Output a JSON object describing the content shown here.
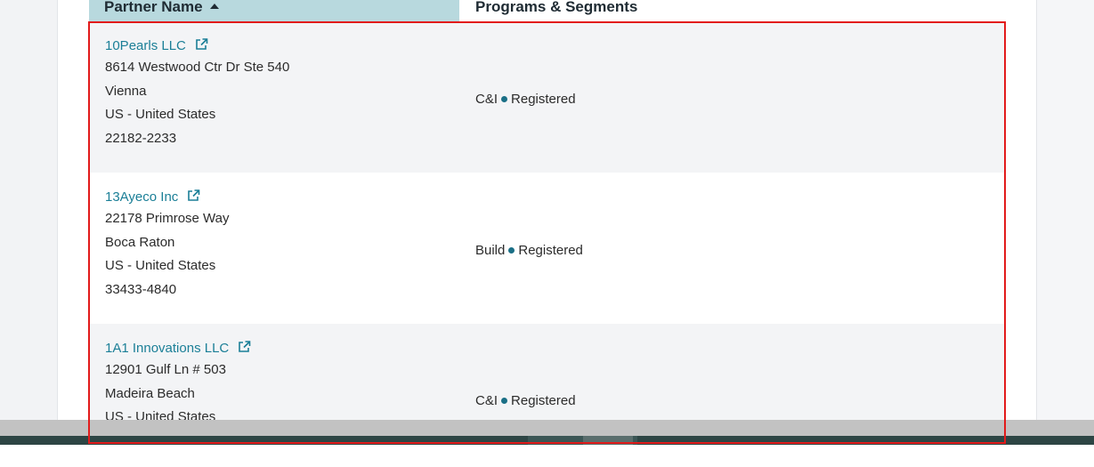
{
  "table": {
    "headers": {
      "partner_name": "Partner Name",
      "programs": "Programs & Segments"
    },
    "rows": [
      {
        "name": "10Pearls LLC",
        "address": [
          "8614 Westwood Ctr Dr Ste 540",
          "Vienna",
          "US - United States",
          "22182-2233"
        ],
        "program": "C&I",
        "segment": "Registered"
      },
      {
        "name": "13Ayeco Inc",
        "address": [
          "22178 Primrose Way",
          "Boca Raton",
          "US - United States",
          "33433-4840"
        ],
        "program": "Build",
        "segment": "Registered"
      },
      {
        "name": "1A1 Innovations LLC",
        "address": [
          "12901 Gulf Ln # 503",
          "Madeira Beach",
          "US - United States"
        ],
        "program": "C&I",
        "segment": "Registered"
      }
    ]
  },
  "icons": {
    "sort": "sort-ascending-icon",
    "external_link": "external-link-icon"
  },
  "colors": {
    "header_highlight": "#b8d9de",
    "link": "#1b7f97",
    "dot": "#1a6f86",
    "selection_border": "#e21b1b"
  }
}
